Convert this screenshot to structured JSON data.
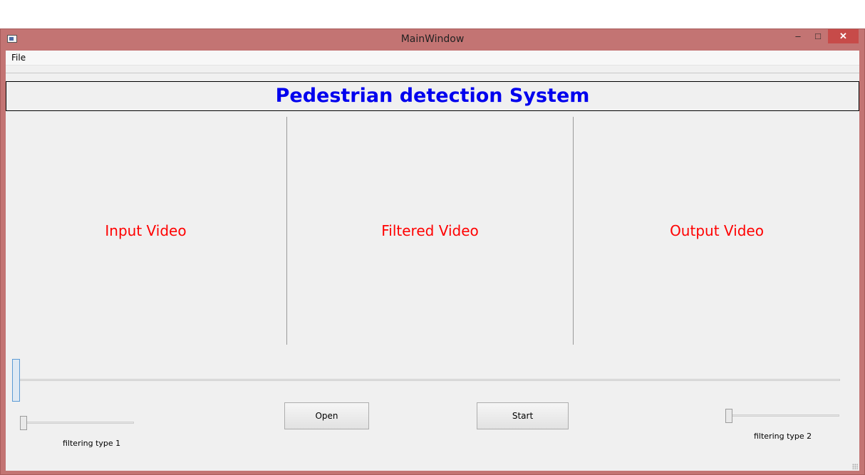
{
  "window": {
    "title": "MainWindow",
    "controls": {
      "minimize": "–",
      "maximize": "□",
      "close": "✕"
    }
  },
  "menubar": {
    "items": [
      "File"
    ]
  },
  "header": {
    "title": "Pedestrian detection System"
  },
  "panels": {
    "input": "Input Video",
    "filtered": "Filtered Video",
    "output": "Output Video"
  },
  "buttons": {
    "open": "Open",
    "start": "Start"
  },
  "sliders": {
    "playback": {
      "level": 0
    },
    "filter1": {
      "label": "filtering type 1",
      "level": 0
    },
    "filter2": {
      "label": "filtering type 2",
      "level": 0
    }
  },
  "colors": {
    "title_bar": "#c37473",
    "header_text": "#0000ee",
    "panel_text": "#ff0000",
    "close_button": "#c74b49"
  }
}
